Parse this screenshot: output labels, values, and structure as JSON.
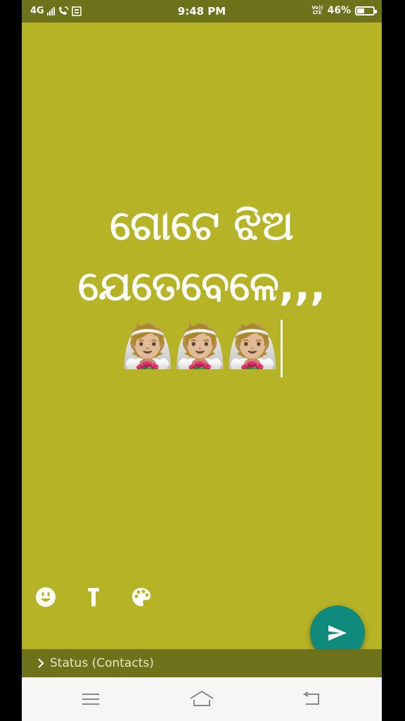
{
  "status_bar": {
    "network": "4G",
    "time": "9:48 PM",
    "volte_line1": "Vo))",
    "volte_line2": "LTE",
    "battery_percent": "46%",
    "battery_level": 0.46,
    "icons": [
      "signal-icon",
      "wifi-call-icon",
      "sim-icon",
      "battery-icon"
    ]
  },
  "editor": {
    "background_color": "#b7b326",
    "text_line1": "ଗୋଟେ ଝିଅ",
    "text_line2": "ଯେତେବେଳେ,,,",
    "emoji_line": "👰🏼👰🏼👰🏼"
  },
  "toolbar": {
    "emoji_icon": "smiley-icon",
    "text_icon": "text-style-icon",
    "color_icon": "palette-icon"
  },
  "send_button": {
    "icon": "send-icon",
    "color": "#0f8a7c"
  },
  "audience": {
    "label": "Status (Contacts)",
    "icon": "chevron-right-icon"
  },
  "navigation": {
    "icons": [
      "menu-icon",
      "home-icon",
      "back-icon"
    ]
  }
}
